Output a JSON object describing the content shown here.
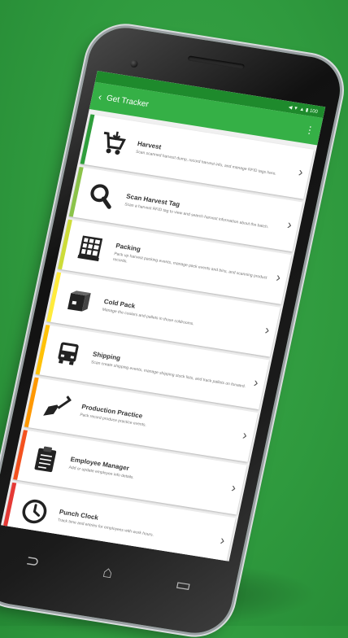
{
  "status": {
    "icons": "◀ ▼ ▲ ▮ 100"
  },
  "appbar": {
    "title": "Get Tracker",
    "back": "‹",
    "more": "⋮"
  },
  "items": [
    {
      "title": "Harvest",
      "desc": "Scan scanned harvest dump, record harvest info, and manage RFID tags here.",
      "icon": "cart-icon",
      "color": "#2e9e3b"
    },
    {
      "title": "Scan Harvest Tag",
      "desc": "Scan a harvest RFID tag to view and search harvest information about the batch.",
      "icon": "magnifier-icon",
      "color": "#8bc34a"
    },
    {
      "title": "Packing",
      "desc": "Pack up harvest packing events, manage pack events and bins, and scanning product records.",
      "icon": "pallet-icon",
      "color": "#cddc39"
    },
    {
      "title": "Cold Pack",
      "desc": "Manage the coolers and pallets in those coldrooms.",
      "icon": "box-icon",
      "color": "#ffeb3b"
    },
    {
      "title": "Shipping",
      "desc": "Scan create shipping events, manage shipping stock lists, and track pallets on forward.",
      "icon": "truck-icon",
      "color": "#ffc107"
    },
    {
      "title": "Production Practice",
      "desc": "Pack record produce practice events.",
      "icon": "shovel-icon",
      "color": "#ff9800"
    },
    {
      "title": "Employee Manager",
      "desc": "Add or update employee info details.",
      "icon": "clipboard-icon",
      "color": "#f4511e"
    },
    {
      "title": "Punch Clock",
      "desc": "Track time and entries for employees with work hours.",
      "icon": "clock-icon",
      "color": "#e53935"
    }
  ],
  "chevron": "›",
  "nav": {
    "back": "⊃",
    "home": "⌂",
    "recents": "▭"
  }
}
